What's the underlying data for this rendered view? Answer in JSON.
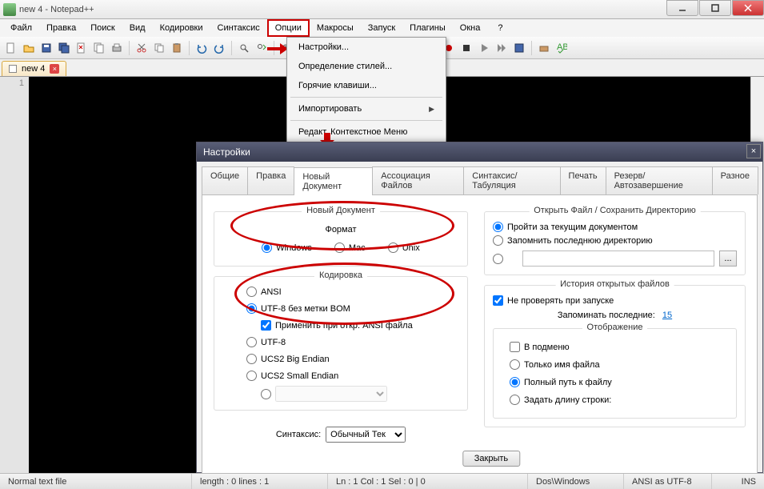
{
  "window": {
    "title": "new  4 - Notepad++"
  },
  "menubar": [
    "Файл",
    "Правка",
    "Поиск",
    "Вид",
    "Кодировки",
    "Синтаксис",
    "Опции",
    "Макросы",
    "Запуск",
    "Плагины",
    "Окна",
    "?"
  ],
  "tab": {
    "name": "new  4"
  },
  "gutter": {
    "line1": "1"
  },
  "dropdown": {
    "items": [
      "Настройки...",
      "Определение стилей...",
      "Горячие клавиши..."
    ],
    "import": "Импортировать",
    "edit_ctx": "Редакт. Контекстное Меню"
  },
  "dialog": {
    "title": "Настройки",
    "tabs": [
      "Общие",
      "Правка",
      "Новый Документ",
      "Ассоциация Файлов",
      "Синтаксис/Табуляция",
      "Печать",
      "Резерв/Автозавершение",
      "Разное"
    ],
    "active_tab": 2,
    "left": {
      "new_doc": {
        "title": "Новый Документ",
        "format": "Формат",
        "windows": "Windows",
        "mac": "Mac",
        "unix": "Unix"
      },
      "encoding": {
        "title": "Кодировка",
        "ansi": "ANSI",
        "utf8bom": "UTF-8 без метки BOM",
        "apply_ansi": "Применить при откр. ANSI файла",
        "utf8": "UTF-8",
        "ucs2be": "UCS2 Big Endian",
        "ucs2le": "UCS2 Small Endian"
      },
      "syntax": {
        "label": "Синтаксис:",
        "value": "Обычный Тек"
      }
    },
    "right": {
      "open": {
        "title": "Открыть Файл / Сохранить Директорию",
        "follow": "Пройти за текущим документом",
        "remember_dir": "Запомнить последнюю директорию",
        "browse": "..."
      },
      "history": {
        "title": "История открытых файлов",
        "nocheck": "Не проверять при запуске",
        "remember_last": "Запоминать последние:",
        "count": "15"
      },
      "display": {
        "title": "Отображение",
        "submenu": "В подменю",
        "name_only": "Только имя файла",
        "fullpath": "Полный путь к файлу",
        "set_len": "Задать длину строки:"
      }
    },
    "close": "Закрыть"
  },
  "status": {
    "mode": "Normal text file",
    "length": "length : 0    lines : 1",
    "pos": "Ln : 1    Col : 1    Sel : 0 | 0",
    "os": "Dos\\Windows",
    "enc": "ANSI as UTF-8",
    "ins": "INS"
  }
}
